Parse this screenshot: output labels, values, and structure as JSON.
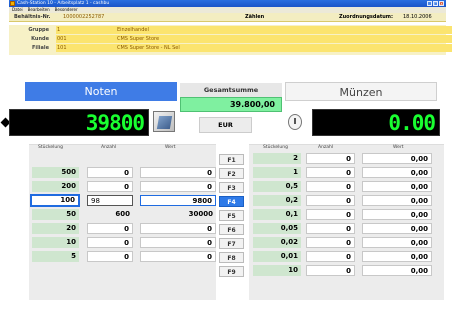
{
  "titlebar": {
    "title": "Cash-Station 10 - Arbeitsplatz 1 - cashbu",
    "buttons": [
      "_",
      "□",
      "x"
    ]
  },
  "menubar": {
    "items": [
      "Datei",
      "Bearbeiten",
      "Besonderer"
    ]
  },
  "infobar": {
    "doc_label": "Behältnis-Nr.",
    "doc_value": "1000002252787",
    "mode": "Zählen",
    "date_label": "Zuordnungsdatum:",
    "date_value": "18.10.2006"
  },
  "info": [
    {
      "key": "Gruppe",
      "code": "1",
      "desc": "Einzelhandel"
    },
    {
      "key": "Kunde",
      "code": "001",
      "desc": "CMS Super Store"
    },
    {
      "key": "Filiale",
      "code": "101",
      "desc": "CMS Super Store - NL Sel"
    }
  ],
  "notes": {
    "banner": "Noten",
    "led": "39800",
    "headers": {
      "denom": "Stückelung",
      "count": "Anzahl",
      "value": "Wert"
    },
    "rows": [
      {
        "denom": "500",
        "count": "0",
        "value": "0"
      },
      {
        "denom": "200",
        "count": "0",
        "value": "0"
      },
      {
        "denom": "100",
        "count": "98",
        "value": "9800"
      },
      {
        "denom": "50",
        "count": "600",
        "value": "30000"
      },
      {
        "denom": "20",
        "count": "0",
        "value": "0"
      },
      {
        "denom": "10",
        "count": "0",
        "value": "0"
      },
      {
        "denom": "5",
        "count": "0",
        "value": "0"
      }
    ]
  },
  "total": {
    "label": "Gesamtsumme",
    "value": "39.800,00",
    "currency": "EUR"
  },
  "fkeys": [
    "F1",
    "F2",
    "F3",
    "F4",
    "F5",
    "F6",
    "F7",
    "F8",
    "F9"
  ],
  "coins": {
    "banner": "Münzen",
    "led": "0.00",
    "headers": {
      "denom": "Stückelung",
      "count": "Anzahl",
      "value": "Wert"
    },
    "rows": [
      {
        "denom": "2",
        "count": "0",
        "value": "0,00"
      },
      {
        "denom": "1",
        "count": "0",
        "value": "0,00"
      },
      {
        "denom": "0,5",
        "count": "0",
        "value": "0,00"
      },
      {
        "denom": "0,2",
        "count": "0",
        "value": "0,00"
      },
      {
        "denom": "0,1",
        "count": "0",
        "value": "0,00"
      },
      {
        "denom": "0,05",
        "count": "0",
        "value": "0,00"
      },
      {
        "denom": "0,02",
        "count": "0",
        "value": "0,00"
      },
      {
        "denom": "0,01",
        "count": "0",
        "value": "0,00"
      },
      {
        "denom": "10",
        "count": "0",
        "value": "0,00"
      }
    ]
  }
}
